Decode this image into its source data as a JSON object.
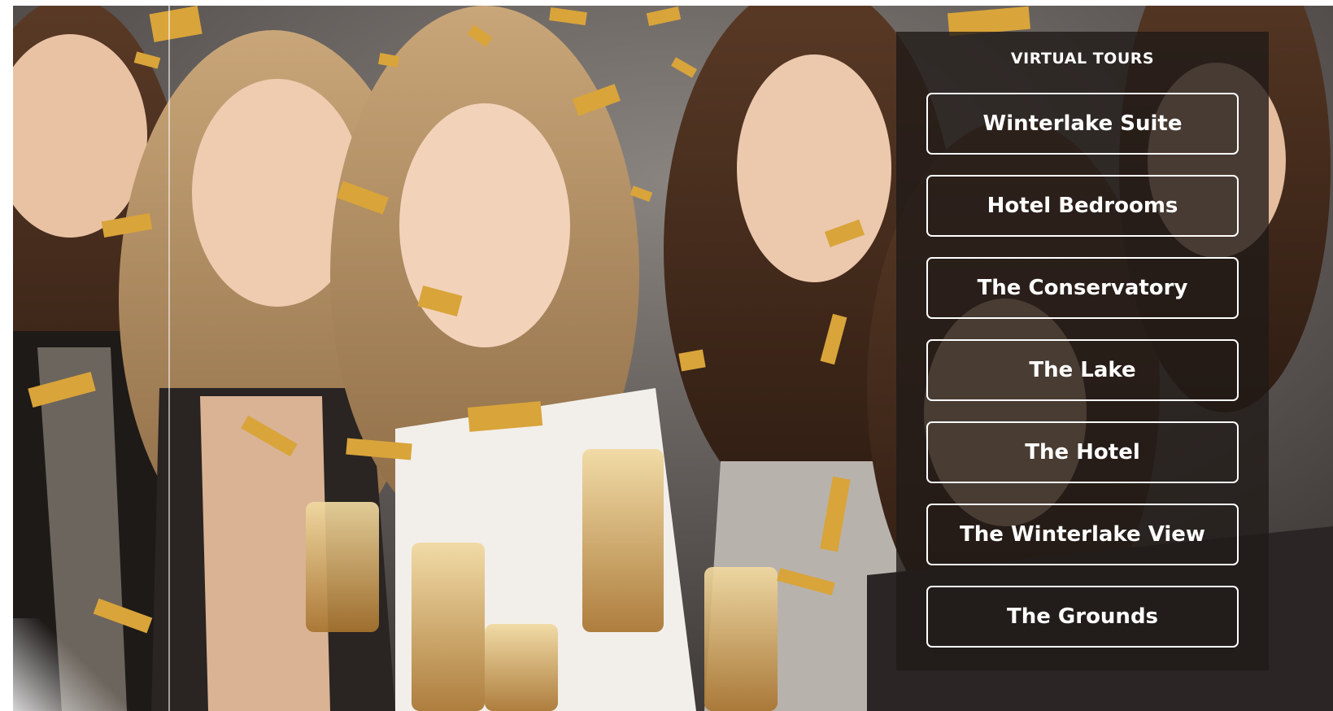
{
  "panel": {
    "title": "VIRTUAL TOURS",
    "buttons": [
      {
        "label": "Winterlake Suite"
      },
      {
        "label": "Hotel Bedrooms"
      },
      {
        "label": "The Conservatory"
      },
      {
        "label": "The Lake"
      },
      {
        "label": "The Hotel"
      },
      {
        "label": "The Winterlake View"
      },
      {
        "label": "The Grounds"
      }
    ]
  },
  "colors": {
    "panel_bg": "#201a18",
    "button_border": "#ffffff",
    "text": "#ffffff",
    "confetti_gold": "#d9a43a"
  }
}
